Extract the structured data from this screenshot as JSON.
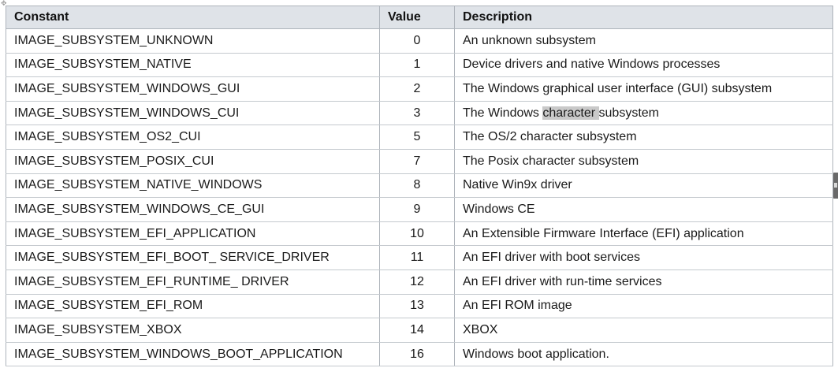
{
  "table": {
    "headers": {
      "constant": "Constant",
      "value": "Value",
      "description": "Description"
    },
    "rows": [
      {
        "constant": "IMAGE_SUBSYSTEM_UNKNOWN",
        "value": "0",
        "description": "An unknown subsystem"
      },
      {
        "constant": "IMAGE_SUBSYSTEM_NATIVE",
        "value": "1",
        "description": "Device drivers and native Windows processes"
      },
      {
        "constant": "IMAGE_SUBSYSTEM_WINDOWS_GUI",
        "value": "2",
        "description": "The Windows graphical user interface (GUI) subsystem"
      },
      {
        "constant": "IMAGE_SUBSYSTEM_WINDOWS_CUI",
        "value": "3",
        "description_before": "The Windows ",
        "description_highlight": "character ",
        "description_after": "subsystem"
      },
      {
        "constant": "IMAGE_SUBSYSTEM_OS2_CUI",
        "value": "5",
        "description": "The OS/2 character subsystem"
      },
      {
        "constant": "IMAGE_SUBSYSTEM_POSIX_CUI",
        "value": "7",
        "description": "The Posix character subsystem"
      },
      {
        "constant": "IMAGE_SUBSYSTEM_NATIVE_WINDOWS",
        "value": "8",
        "description": "Native Win9x driver"
      },
      {
        "constant": "IMAGE_SUBSYSTEM_WINDOWS_CE_GUI",
        "value": "9",
        "description": "Windows CE"
      },
      {
        "constant": "IMAGE_SUBSYSTEM_EFI_APPLICATION",
        "value": "10",
        "description": "An Extensible Firmware Interface (EFI) application"
      },
      {
        "constant": "IMAGE_SUBSYSTEM_EFI_BOOT_ SERVICE_DRIVER",
        "value": "11",
        "description": "An EFI driver with boot services"
      },
      {
        "constant": "IMAGE_SUBSYSTEM_EFI_RUNTIME_ DRIVER",
        "value": "12",
        "description": "An EFI driver with run-time services"
      },
      {
        "constant": "IMAGE_SUBSYSTEM_EFI_ROM",
        "value": "13",
        "description": "An EFI ROM image"
      },
      {
        "constant": "IMAGE_SUBSYSTEM_XBOX",
        "value": "14",
        "description": "XBOX"
      },
      {
        "constant": "IMAGE_SUBSYSTEM_WINDOWS_BOOT_APPLICATION",
        "value": "16",
        "description": "Windows boot application."
      }
    ]
  },
  "colors": {
    "header_background": "#dfe3e8",
    "border": "#aeb4bb",
    "text_highlight": "#c9c9c9"
  }
}
